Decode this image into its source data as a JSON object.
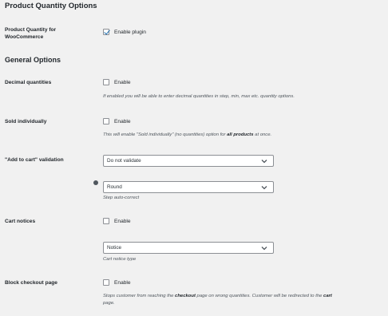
{
  "page": {
    "title": "Product Quantity Options"
  },
  "plugin": {
    "label_line1": "Product Quantity for",
    "label_line2": "WooCommerce",
    "checkbox_label": "Enable plugin",
    "checked": true
  },
  "general": {
    "title": "General Options"
  },
  "decimal": {
    "label": "Decimal quantities",
    "checkbox_label": "Enable",
    "desc": "If enabled you will be able to enter decimal quantities in step, min, max etc. quantity options."
  },
  "sold_individually": {
    "label": "Sold individually",
    "checkbox_label": "Enable",
    "desc_pre": "This will enable \"Sold individually\" (no quantities) option for ",
    "desc_bold": "all products",
    "desc_post": " at once."
  },
  "add_to_cart": {
    "label": "\"Add to cart\" validation",
    "select_value": "Do not validate",
    "step_select_value": "Round",
    "step_desc": "Step auto-correct"
  },
  "cart_notices": {
    "label": "Cart notices",
    "checkbox_label": "Enable",
    "select_value": "Notice",
    "desc": "Cart notice type"
  },
  "block_checkout": {
    "label": "Block checkout page",
    "checkbox_label": "Enable",
    "desc_pre": "Stops customer from reaching the ",
    "desc_bold1": "checkout",
    "desc_mid": " page on wrong quantities. Customer will be redirected to the ",
    "desc_bold2": "cart",
    "desc_line2": "page."
  },
  "icons": {
    "checkbox": "checkbox-icon",
    "chevron": "chevron-down-icon",
    "help": "help-icon"
  }
}
